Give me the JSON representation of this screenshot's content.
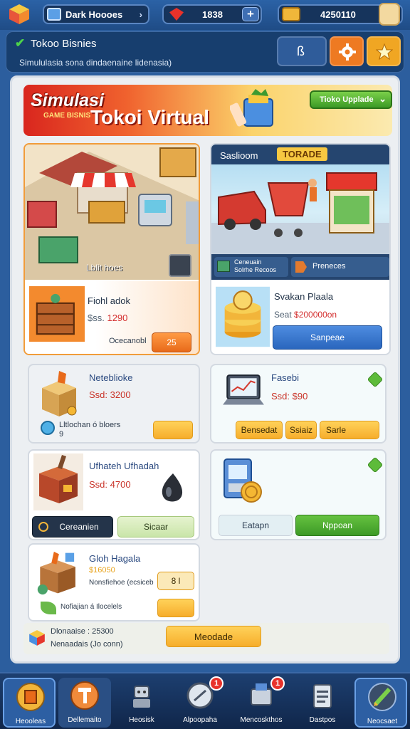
{
  "topbar": {
    "store_name": "Dark Hoooes",
    "gems": "1838",
    "coins": "4250110"
  },
  "header": {
    "title": "Tokoo Bisnies",
    "subtitle": "Simululasia sona dindaenaine lidenasia)",
    "buttons": [
      {
        "icon": "profile-icon",
        "label": "ß",
        "color": "#2f5c9a"
      },
      {
        "icon": "gear-icon",
        "color": "#ee7a22"
      },
      {
        "icon": "star-icon",
        "color": "#f0a623"
      }
    ]
  },
  "banner": {
    "simulasi": "Simulasi",
    "simulasi_sub": "GAME BISNIS",
    "title": "Tokoi Virtual",
    "upgrade_label": "Tioko Upplade"
  },
  "cards": {
    "store": {
      "caption": "Lblit hoes",
      "item_name": "Fiohl adok",
      "price_prefix": "$ss.",
      "price": "1290",
      "action_label": "Ocecanobl",
      "count": "25"
    },
    "delivery": {
      "header_label": "Saslioom",
      "header_badge": "TORADE",
      "tab1": "Ceneuain\nSolrhe Recoos",
      "tab2": "Preneces",
      "item_name": "Svakan Plaala",
      "price_prefix": "Seat",
      "price": "$200000on",
      "action_label": "Sanpeae"
    },
    "box": {
      "item_name": "Neteblioke",
      "price": "Ssd: 3200",
      "detail": "Lltlochan ó bloers\n9"
    },
    "laptop": {
      "item_name": "Fasebi",
      "price": "Ssd: $90",
      "btn1": "Bensedat",
      "btn2": "Ssiaiz",
      "btn3": "Sarle"
    },
    "crate": {
      "item_name": "Ufhateh Ufhadah",
      "price": "Ssd: 4700",
      "btn1": "Cereanien",
      "btn2": "Sicaar"
    },
    "machine": {
      "btn1": "Eatapn",
      "btn2": "Nppoan"
    },
    "gift": {
      "item_name": "Gloh Hagala",
      "price": "$16050",
      "detail": "Nonsfiehoe (ecsiceb",
      "qty": "8 l",
      "extra": "Nofiajian á Ilocelels"
    }
  },
  "footer": {
    "line1": "Dlonaaise : 25300",
    "line2": "Nenaadais (Jo conn)",
    "button": "Meodade"
  },
  "nav": [
    {
      "label": "Heooleas",
      "icon": "store-icon",
      "badge": null
    },
    {
      "label": "Dellemaito",
      "icon": "hammer-icon",
      "badge": null
    },
    {
      "label": "Heosisk",
      "icon": "robot-icon",
      "badge": null
    },
    {
      "label": "Alpoopaha",
      "icon": "compass-icon",
      "badge": "1"
    },
    {
      "label": "Mencoskthos",
      "icon": "cart-icon",
      "badge": "1"
    },
    {
      "label": "Dastpos",
      "icon": "clipboard-icon",
      "badge": null
    },
    {
      "label": "Neocsaet",
      "icon": "pencil-icon",
      "badge": null
    }
  ]
}
